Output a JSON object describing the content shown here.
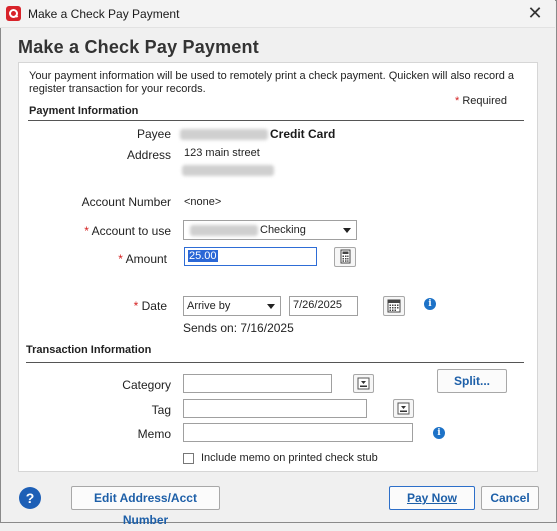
{
  "window": {
    "title": "Make a Check Pay Payment",
    "close_glyph": "✕"
  },
  "heading": "Make a Check Pay Payment",
  "intro": "Your payment information will be used to remotely print a check payment. Quicken will also record a register transaction for your records.",
  "required_note": "Required",
  "payment_section": {
    "title": "Payment Information",
    "payee_label": "Payee",
    "payee_value": "Credit Card",
    "address_label": "Address",
    "address_line1": "123 main street",
    "account_number_label": "Account Number",
    "account_number_value": "<none>",
    "account_to_use_label": "Account to use",
    "account_to_use_value": "Checking",
    "amount_label": "Amount",
    "amount_value": "25.00",
    "date_label": "Date",
    "date_mode": "Arrive by",
    "date_value": "7/26/2025",
    "sends_on": "Sends on: 7/16/2025"
  },
  "transaction_section": {
    "title": "Transaction Information",
    "category_label": "Category",
    "category_value": "",
    "split_button": "Split...",
    "tag_label": "Tag",
    "tag_value": "",
    "memo_label": "Memo",
    "memo_value": "",
    "include_memo_label": "Include memo on printed check stub"
  },
  "footer": {
    "help_glyph": "?",
    "edit_button": "Edit Address/Acct Number",
    "pay_now_button": "Pay Now",
    "cancel_button": "Cancel"
  },
  "icons": {
    "app": "quicken-logo-icon",
    "calculator": "calculator-icon",
    "calendar": "calendar-icon",
    "info": "info-icon",
    "picker": "list-picker-icon"
  },
  "colors": {
    "accent": "#1d5fa8",
    "required": "#d42121",
    "selection": "#2a67d6"
  }
}
